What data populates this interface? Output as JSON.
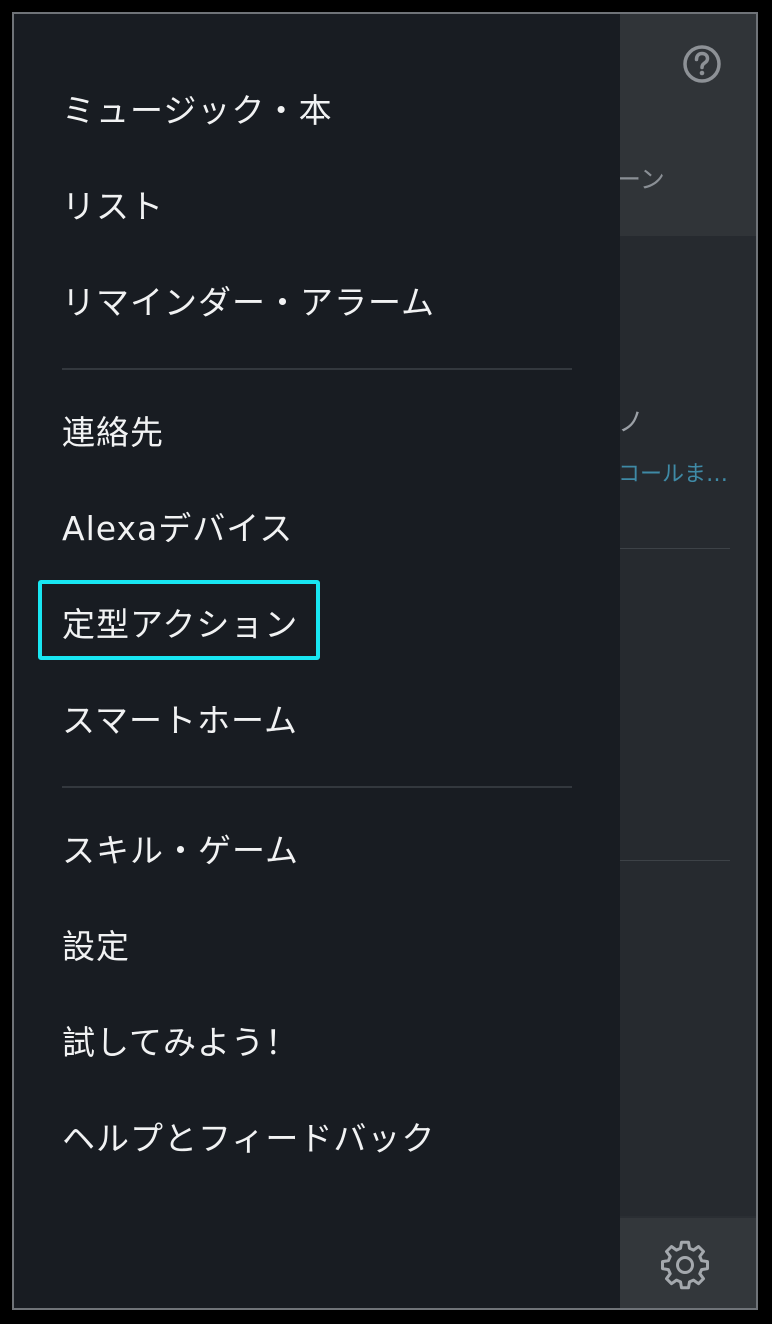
{
  "background": {
    "tab_fragment": "ーン",
    "card_fragment_title": "ノ",
    "card_fragment_link": "コールま…",
    "help_icon": "question-circle-icon",
    "settings_icon": "gear-icon"
  },
  "menu": {
    "groups": [
      {
        "items": [
          {
            "label": "ミュージック・本"
          },
          {
            "label": "リスト"
          },
          {
            "label": "リマインダー・アラーム"
          }
        ]
      },
      {
        "items": [
          {
            "label": "連絡先"
          },
          {
            "label": "Alexaデバイス"
          },
          {
            "label": "定型アクション",
            "highlighted": true
          },
          {
            "label": "スマートホーム"
          }
        ]
      },
      {
        "items": [
          {
            "label": "スキル・ゲーム"
          },
          {
            "label": "設定"
          },
          {
            "label": "試してみよう！"
          },
          {
            "label": "ヘルプとフィードバック"
          }
        ]
      }
    ]
  },
  "colors": {
    "drawer_background": "#181c22",
    "menu_text": "#f1f2f3",
    "highlight_border": "#18e6f2",
    "link_text": "#3f8aa6"
  }
}
